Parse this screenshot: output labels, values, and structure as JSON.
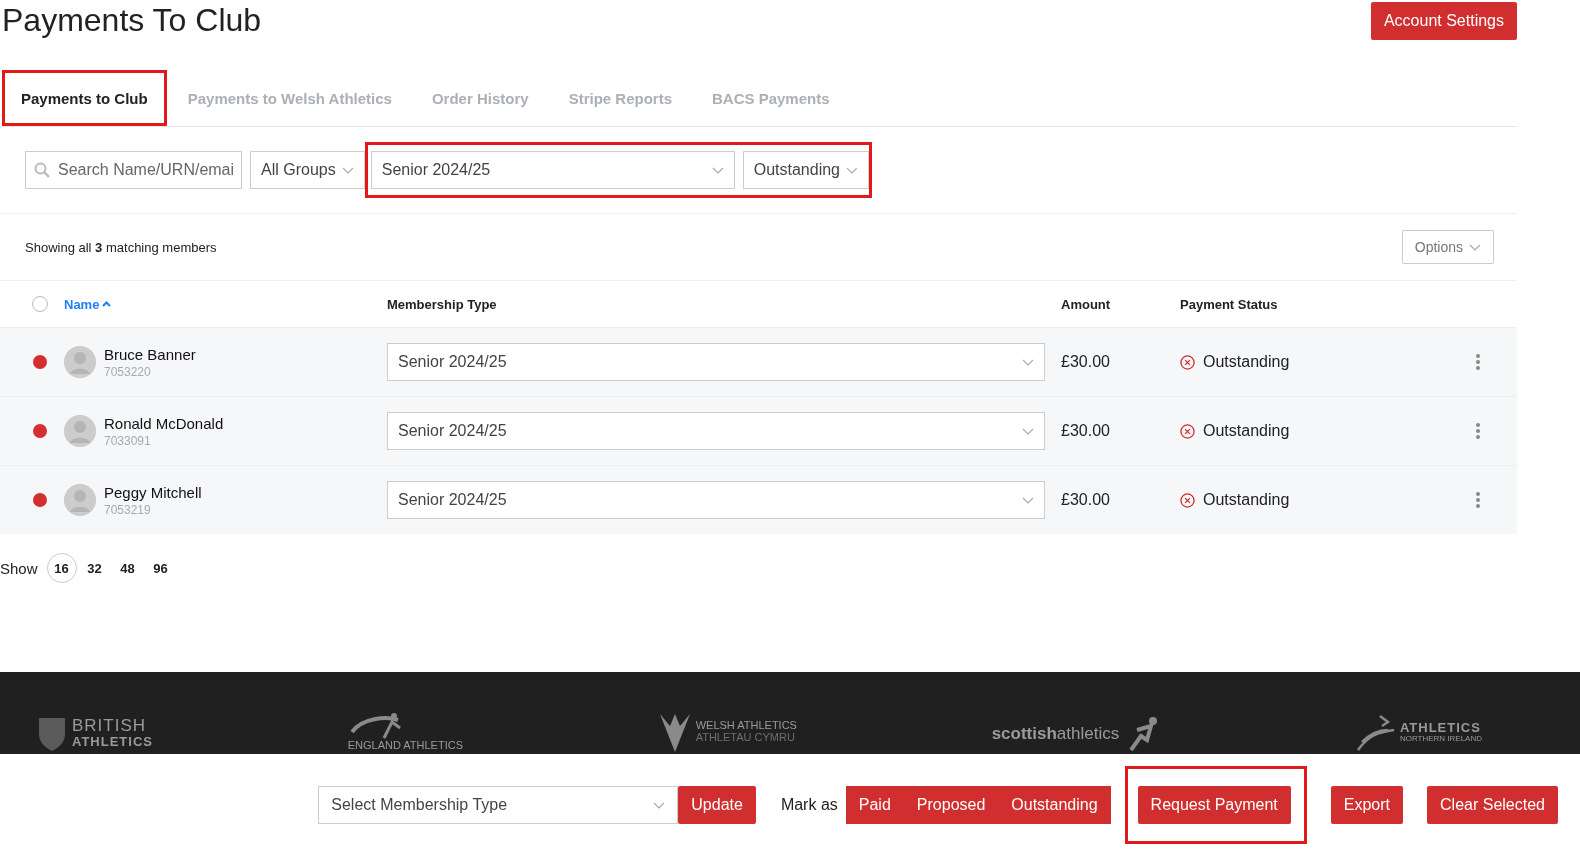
{
  "page": {
    "title": "Payments To Club",
    "account_button": "Account Settings"
  },
  "tabs": [
    {
      "label": "Payments to Club",
      "selected": true,
      "highlighted": true
    },
    {
      "label": "Payments to Welsh Athletics",
      "selected": false,
      "highlighted": false
    },
    {
      "label": "Order History",
      "selected": false,
      "highlighted": false
    },
    {
      "label": "Stripe Reports",
      "selected": false,
      "highlighted": false
    },
    {
      "label": "BACS Payments",
      "selected": false,
      "highlighted": false
    }
  ],
  "filters": {
    "search": {
      "placeholder": "Search Name/URN/emai"
    },
    "group": "All Groups",
    "membership": "Senior 2024/25",
    "status": "Outstanding",
    "highlighted": true
  },
  "summary": "Showing all **3** matching members",
  "options_button": "Options",
  "table": {
    "select_all": {
      "checked": false
    },
    "columns": [
      {
        "label": "Name",
        "sorted": true
      },
      {
        "label": "Membership Type",
        "sorted": false
      },
      {
        "label": "Amount",
        "sorted": false
      },
      {
        "label": "Payment Status",
        "sorted": false
      }
    ],
    "rows": [
      {
        "name": "Bruce Banner",
        "urn": "7053220",
        "color": "#d32f2f",
        "membership": "Senior 2024/25",
        "amount": "£30.00",
        "status": "Outstanding"
      },
      {
        "name": "Ronald McDonald",
        "urn": "7033091",
        "color": "#d32f2f",
        "membership": "Senior 2024/25",
        "amount": "£30.00",
        "status": "Outstanding"
      },
      {
        "name": "Peggy Mitchell",
        "urn": "7053219",
        "color": "#d32f2f",
        "membership": "Senior 2024/25",
        "amount": "£30.00",
        "status": "Outstanding"
      }
    ]
  },
  "pager": {
    "label": "Show",
    "sizes": [
      {
        "label": "16",
        "selected": true
      },
      {
        "label": "32",
        "selected": false
      },
      {
        "label": "48",
        "selected": false
      },
      {
        "label": "96",
        "selected": false
      }
    ]
  },
  "footer_logos": [
    {
      "kind": "crest",
      "lines": [
        "BRITISH",
        "ATHLETICS"
      ]
    },
    {
      "kind": "swoosh",
      "lines": [
        "ENGLAND ATHLETICS"
      ]
    },
    {
      "kind": "feathers",
      "lines": [
        "WELSH ATHLETICS",
        "ATHLETAU CYMRU"
      ]
    },
    {
      "kind": "wordmark",
      "lines": [
        "**scottish**athletics"
      ]
    },
    {
      "kind": "runner",
      "lines": [
        "ATHLETICS",
        "NORTHERN IRELAND"
      ]
    }
  ],
  "actions": {
    "select_placeholder": "Select Membership Type",
    "update_button": "Update",
    "mark_label": "Mark as",
    "mark_buttons": [
      "Paid",
      "Proposed",
      "Outstanding"
    ],
    "buttons": [
      {
        "label": "Request Payment",
        "highlighted": true
      },
      {
        "label": "Export",
        "highlighted": false
      },
      {
        "label": "Clear Selected",
        "highlighted": false
      }
    ]
  }
}
